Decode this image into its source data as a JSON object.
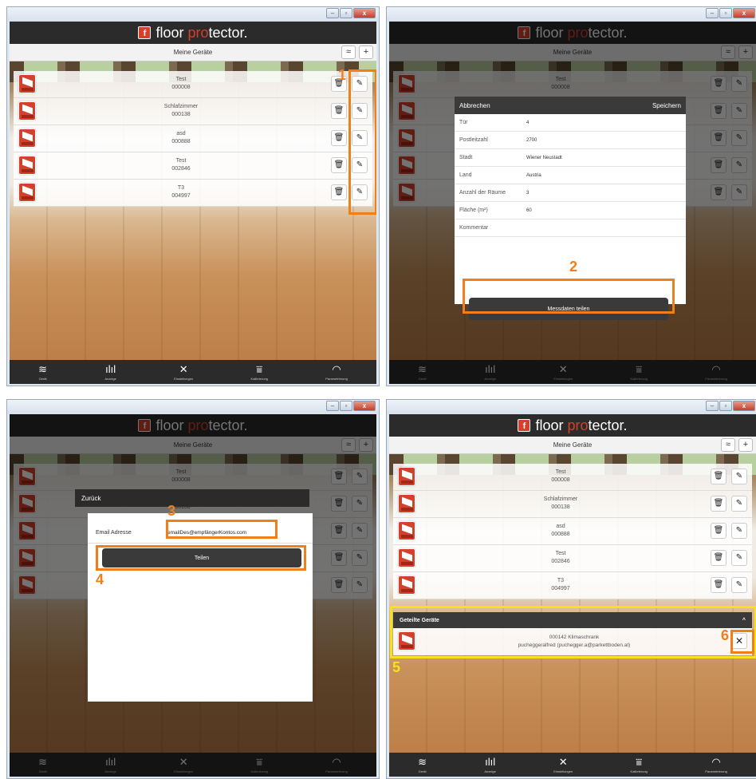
{
  "app": {
    "logo_badge": "f",
    "logo_word1": "floor ",
    "logo_word2": "pro",
    "logo_word3": "tector.",
    "subtitle": "Meine Geräte",
    "wifi_icon": "≈",
    "plus_label": "+"
  },
  "window_controls": {
    "minimize": "–",
    "maximize": "▫",
    "close": "x"
  },
  "devices": [
    {
      "name": "Test",
      "id": "000008"
    },
    {
      "name": "Schlafzimmer",
      "id": "000138"
    },
    {
      "name": "asd",
      "id": "000888"
    },
    {
      "name": "Test",
      "id": "002846"
    },
    {
      "name": "T3",
      "id": "004997"
    }
  ],
  "footer": [
    {
      "icon": "≋",
      "label": "Gerät"
    },
    {
      "icon": "ılıl",
      "label": "Anzeige"
    },
    {
      "icon": "✕",
      "label": "Einstellungen"
    },
    {
      "icon": "⩸",
      "label": "Kalibrierung"
    },
    {
      "icon": "◠",
      "label": "Parametrierung"
    }
  ],
  "edit_modal": {
    "cancel": "Abbrechen",
    "save": "Speichern",
    "fields": [
      {
        "label": "Tür",
        "value": "4"
      },
      {
        "label": "Postleitzahl",
        "value": "2700"
      },
      {
        "label": "Stadt",
        "value": "Wiener Neustadt"
      },
      {
        "label": "Land",
        "value": "Austria"
      },
      {
        "label": "Anzahl der Räume",
        "value": "3"
      },
      {
        "label": "Fläche (m²)",
        "value": "60"
      },
      {
        "label": "Kommentar",
        "value": ""
      }
    ],
    "share_button": "Messdaten teilen"
  },
  "share_modal": {
    "back": "Zurück",
    "email_label": "Email Adresse",
    "email_value": "emailDes@empfängerKontos.com",
    "share_button": "Teilen"
  },
  "shared_devices": {
    "title": "Geteilte Geräte",
    "collapse_icon": "^",
    "item_line1": "000142 Klimaschrank",
    "item_line2": "pucheggeralfred (puchegger.a@parkettboden.at)",
    "remove_label": "✕"
  },
  "annotations": [
    "1",
    "2",
    "3",
    "4",
    "5",
    "6"
  ],
  "colors": {
    "accent": "#d3402b",
    "highlight_orange": "#f07f1a",
    "highlight_yellow": "#f6e21a",
    "bar": "#2b2b2b"
  }
}
